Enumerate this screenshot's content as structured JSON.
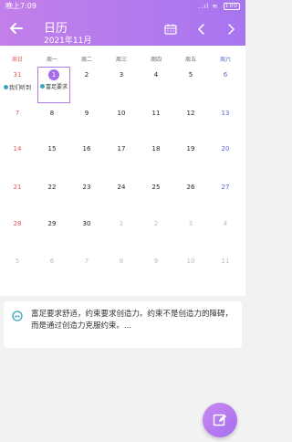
{
  "status": {
    "time": "晚上7:09",
    "signal": "..ıl",
    "wifi": "≋",
    "battery": "100"
  },
  "header": {
    "title": "日历",
    "subtitle": "2021年11月"
  },
  "weekdays": [
    "周日",
    "周一",
    "周二",
    "周三",
    "周四",
    "周五",
    "周六"
  ],
  "weeks": [
    [
      "31",
      "1",
      "2",
      "3",
      "4",
      "5",
      "6"
    ],
    [
      "7",
      "8",
      "9",
      "10",
      "11",
      "12",
      "13"
    ],
    [
      "14",
      "15",
      "16",
      "17",
      "18",
      "19",
      "20"
    ],
    [
      "21",
      "22",
      "23",
      "24",
      "25",
      "26",
      "27"
    ],
    [
      "28",
      "29",
      "30",
      "1",
      "2",
      "3",
      "4"
    ],
    [
      "5",
      "6",
      "7",
      "8",
      "9",
      "10",
      "11"
    ]
  ],
  "events": {
    "sun_w1": "我们听到",
    "mon_w1": "富足要求"
  },
  "quote": {
    "text": "富足要求舒适，约束要求创造力。约束不是创造力的障碍，而是通过创造力克服约束。..."
  },
  "colors": {
    "accent": "#a66bea",
    "sunday": "#e85a5a",
    "saturday": "#5a63d8",
    "event_dot": "#3aa3c2"
  }
}
